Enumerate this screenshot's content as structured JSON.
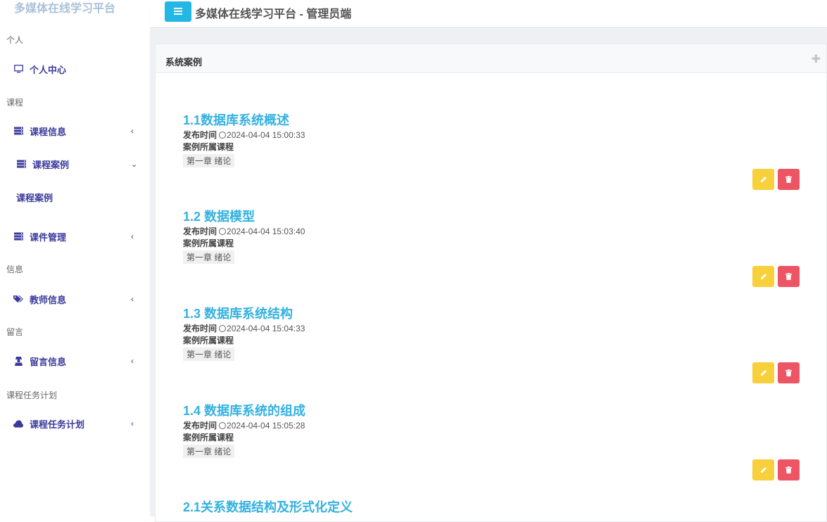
{
  "app": {
    "brand": "多媒体在线学习平台",
    "title": "多媒体在线学习平台 - 管理员端"
  },
  "sidebar": {
    "sections": [
      {
        "label": "个人"
      },
      {
        "label": "课程"
      },
      {
        "label": "信息"
      },
      {
        "label": "留言"
      },
      {
        "label": "课程任务计划"
      }
    ],
    "items": [
      {
        "label": "个人中心",
        "icon": "monitor-icon"
      },
      {
        "label": "课程信息",
        "icon": "server-icon"
      },
      {
        "label": "课程案例",
        "icon": "server-icon"
      },
      {
        "label": "课件管理",
        "icon": "server-icon"
      },
      {
        "label": "教师信息",
        "icon": "tags-icon"
      },
      {
        "label": "留言信息",
        "icon": "user-secret-icon"
      },
      {
        "label": "课程任务计划",
        "icon": "cloud-icon"
      }
    ],
    "subitem": "课程案例"
  },
  "panel": {
    "title": "系统案例"
  },
  "labels": {
    "publish_time": "发布时间",
    "course": "案例所属课程"
  },
  "cases": [
    {
      "title": "1.1数据库系统概述",
      "time": "2024-04-04 15:00:33",
      "course": "第一章 绪论"
    },
    {
      "title": "1.2 数据模型",
      "time": "2024-04-04 15:03:40",
      "course": "第一章 绪论"
    },
    {
      "title": "1.3 数据库系统结构",
      "time": "2024-04-04 15:04:33",
      "course": "第一章 绪论"
    },
    {
      "title": "1.4 数据库系统的组成",
      "time": "2024-04-04 15:05:28",
      "course": "第一章 绪论"
    },
    {
      "title": "2.1关系数据结构及形式化定义"
    }
  ],
  "colors": {
    "accent": "#23b7e5",
    "title": "#34b1e0",
    "nav": "#3b3a9c",
    "edit": "#f8d03c",
    "delete": "#ed5565"
  }
}
